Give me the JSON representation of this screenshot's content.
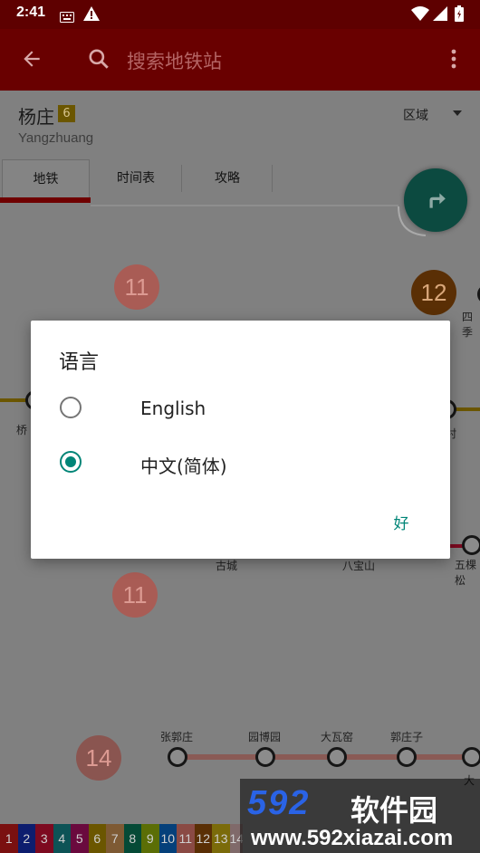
{
  "status_bar": {
    "time": "2:41"
  },
  "app_bar": {
    "search_placeholder": "搜索地铁站"
  },
  "header": {
    "station_name": "杨庄",
    "line_number": "6",
    "pinyin": "Yangzhuang",
    "region_label": "区域",
    "tabs": [
      {
        "label": "地铁"
      },
      {
        "label": "时间表"
      },
      {
        "label": "攻略"
      }
    ]
  },
  "map": {
    "line_circles": [
      {
        "label": "11",
        "color": "#a95c55"
      },
      {
        "label": "12",
        "color": "#5a2f05"
      },
      {
        "label": "11",
        "color": "#a95c55"
      },
      {
        "label": "14",
        "color": "#8a5550"
      }
    ],
    "stations": [
      {
        "name": "四季"
      },
      {
        "name": "桥"
      },
      {
        "name": "村"
      },
      {
        "name": "古城"
      },
      {
        "name": "八宝山"
      },
      {
        "name": "五棵松"
      },
      {
        "name": "张郭庄"
      },
      {
        "name": "园博园"
      },
      {
        "name": "大瓦窑"
      },
      {
        "name": "郭庄子"
      },
      {
        "name": "大"
      }
    ],
    "line_strip": [
      {
        "label": "1",
        "color": "#7a1010"
      },
      {
        "label": "2",
        "color": "#0d1d6e"
      },
      {
        "label": "3",
        "color": "#7d0a20"
      },
      {
        "label": "4",
        "color": "#0d5356"
      },
      {
        "label": "5",
        "color": "#6a0a3e"
      },
      {
        "label": "6",
        "color": "#6b5600"
      },
      {
        "label": "7",
        "color": "#7e5a34"
      },
      {
        "label": "8",
        "color": "#054a36"
      },
      {
        "label": "9",
        "color": "#5b6e06"
      },
      {
        "label": "10",
        "color": "#05407a"
      },
      {
        "label": "11",
        "color": "#8a4a44"
      },
      {
        "label": "12",
        "color": "#5a2f05"
      },
      {
        "label": "13",
        "color": "#7b6b0a"
      },
      {
        "label": "14",
        "color": "#806a6a"
      }
    ]
  },
  "dialog": {
    "title": "语言",
    "options": [
      {
        "label": "English",
        "selected": false
      },
      {
        "label": "中文(简体)",
        "selected": true
      }
    ],
    "ok_label": "好",
    "accent_color": "#008577"
  },
  "watermark": {
    "number": "592",
    "name": "软件园",
    "url": "www.592xiazai.com"
  }
}
